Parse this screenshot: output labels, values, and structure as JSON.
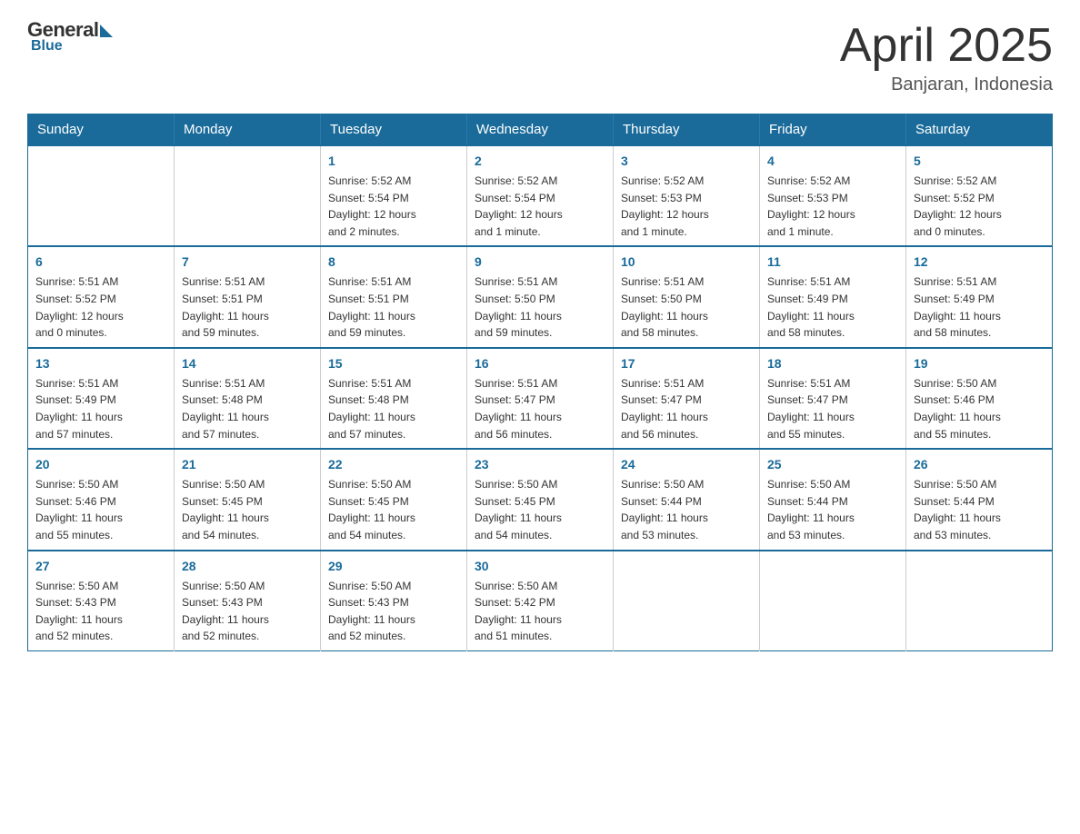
{
  "header": {
    "logo_general": "General",
    "logo_blue": "Blue",
    "month_title": "April 2025",
    "location": "Banjaran, Indonesia"
  },
  "calendar": {
    "days_of_week": [
      "Sunday",
      "Monday",
      "Tuesday",
      "Wednesday",
      "Thursday",
      "Friday",
      "Saturday"
    ],
    "weeks": [
      [
        {
          "day": "",
          "info": ""
        },
        {
          "day": "",
          "info": ""
        },
        {
          "day": "1",
          "info": "Sunrise: 5:52 AM\nSunset: 5:54 PM\nDaylight: 12 hours\nand 2 minutes."
        },
        {
          "day": "2",
          "info": "Sunrise: 5:52 AM\nSunset: 5:54 PM\nDaylight: 12 hours\nand 1 minute."
        },
        {
          "day": "3",
          "info": "Sunrise: 5:52 AM\nSunset: 5:53 PM\nDaylight: 12 hours\nand 1 minute."
        },
        {
          "day": "4",
          "info": "Sunrise: 5:52 AM\nSunset: 5:53 PM\nDaylight: 12 hours\nand 1 minute."
        },
        {
          "day": "5",
          "info": "Sunrise: 5:52 AM\nSunset: 5:52 PM\nDaylight: 12 hours\nand 0 minutes."
        }
      ],
      [
        {
          "day": "6",
          "info": "Sunrise: 5:51 AM\nSunset: 5:52 PM\nDaylight: 12 hours\nand 0 minutes."
        },
        {
          "day": "7",
          "info": "Sunrise: 5:51 AM\nSunset: 5:51 PM\nDaylight: 11 hours\nand 59 minutes."
        },
        {
          "day": "8",
          "info": "Sunrise: 5:51 AM\nSunset: 5:51 PM\nDaylight: 11 hours\nand 59 minutes."
        },
        {
          "day": "9",
          "info": "Sunrise: 5:51 AM\nSunset: 5:50 PM\nDaylight: 11 hours\nand 59 minutes."
        },
        {
          "day": "10",
          "info": "Sunrise: 5:51 AM\nSunset: 5:50 PM\nDaylight: 11 hours\nand 58 minutes."
        },
        {
          "day": "11",
          "info": "Sunrise: 5:51 AM\nSunset: 5:49 PM\nDaylight: 11 hours\nand 58 minutes."
        },
        {
          "day": "12",
          "info": "Sunrise: 5:51 AM\nSunset: 5:49 PM\nDaylight: 11 hours\nand 58 minutes."
        }
      ],
      [
        {
          "day": "13",
          "info": "Sunrise: 5:51 AM\nSunset: 5:49 PM\nDaylight: 11 hours\nand 57 minutes."
        },
        {
          "day": "14",
          "info": "Sunrise: 5:51 AM\nSunset: 5:48 PM\nDaylight: 11 hours\nand 57 minutes."
        },
        {
          "day": "15",
          "info": "Sunrise: 5:51 AM\nSunset: 5:48 PM\nDaylight: 11 hours\nand 57 minutes."
        },
        {
          "day": "16",
          "info": "Sunrise: 5:51 AM\nSunset: 5:47 PM\nDaylight: 11 hours\nand 56 minutes."
        },
        {
          "day": "17",
          "info": "Sunrise: 5:51 AM\nSunset: 5:47 PM\nDaylight: 11 hours\nand 56 minutes."
        },
        {
          "day": "18",
          "info": "Sunrise: 5:51 AM\nSunset: 5:47 PM\nDaylight: 11 hours\nand 55 minutes."
        },
        {
          "day": "19",
          "info": "Sunrise: 5:50 AM\nSunset: 5:46 PM\nDaylight: 11 hours\nand 55 minutes."
        }
      ],
      [
        {
          "day": "20",
          "info": "Sunrise: 5:50 AM\nSunset: 5:46 PM\nDaylight: 11 hours\nand 55 minutes."
        },
        {
          "day": "21",
          "info": "Sunrise: 5:50 AM\nSunset: 5:45 PM\nDaylight: 11 hours\nand 54 minutes."
        },
        {
          "day": "22",
          "info": "Sunrise: 5:50 AM\nSunset: 5:45 PM\nDaylight: 11 hours\nand 54 minutes."
        },
        {
          "day": "23",
          "info": "Sunrise: 5:50 AM\nSunset: 5:45 PM\nDaylight: 11 hours\nand 54 minutes."
        },
        {
          "day": "24",
          "info": "Sunrise: 5:50 AM\nSunset: 5:44 PM\nDaylight: 11 hours\nand 53 minutes."
        },
        {
          "day": "25",
          "info": "Sunrise: 5:50 AM\nSunset: 5:44 PM\nDaylight: 11 hours\nand 53 minutes."
        },
        {
          "day": "26",
          "info": "Sunrise: 5:50 AM\nSunset: 5:44 PM\nDaylight: 11 hours\nand 53 minutes."
        }
      ],
      [
        {
          "day": "27",
          "info": "Sunrise: 5:50 AM\nSunset: 5:43 PM\nDaylight: 11 hours\nand 52 minutes."
        },
        {
          "day": "28",
          "info": "Sunrise: 5:50 AM\nSunset: 5:43 PM\nDaylight: 11 hours\nand 52 minutes."
        },
        {
          "day": "29",
          "info": "Sunrise: 5:50 AM\nSunset: 5:43 PM\nDaylight: 11 hours\nand 52 minutes."
        },
        {
          "day": "30",
          "info": "Sunrise: 5:50 AM\nSunset: 5:42 PM\nDaylight: 11 hours\nand 51 minutes."
        },
        {
          "day": "",
          "info": ""
        },
        {
          "day": "",
          "info": ""
        },
        {
          "day": "",
          "info": ""
        }
      ]
    ]
  }
}
